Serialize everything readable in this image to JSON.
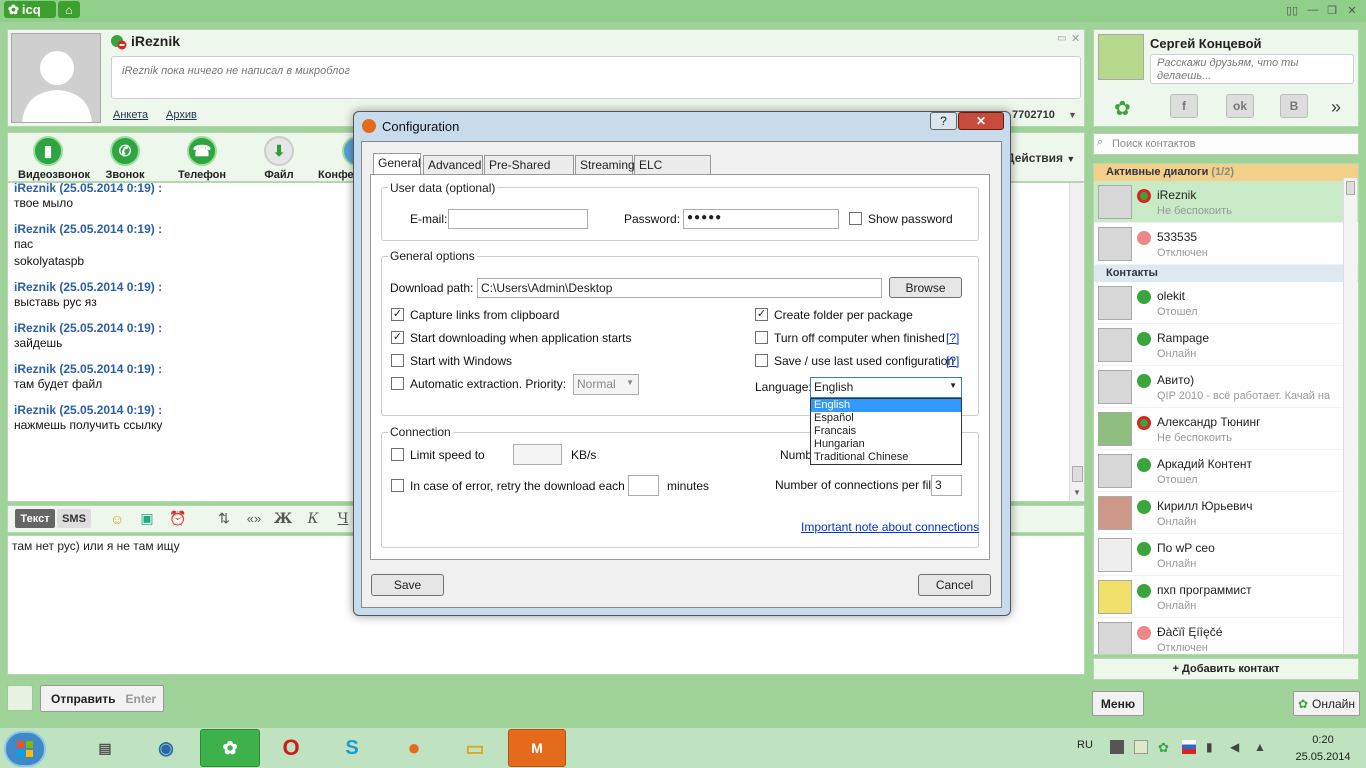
{
  "app": {
    "logo_text": "icq"
  },
  "chat": {
    "contact_name": "iReznik",
    "microblog": "iReznik пока ничего не написал в микроблог",
    "links": {
      "profile": "Анкета",
      "archive": "Архив"
    },
    "uin": "7702710",
    "actions_label": "Действия",
    "toolbar": [
      {
        "label": "Видеозвонок"
      },
      {
        "label": "Звонок"
      },
      {
        "label": "Телефон"
      },
      {
        "label": "Файл"
      },
      {
        "label": "Конфе"
      }
    ],
    "messages": [
      {
        "author": "iReznik (25.05.2014 0:19) :",
        "lines": [
          "твое мыло"
        ]
      },
      {
        "author": "iReznik (25.05.2014 0:19) :",
        "lines": [
          "пас",
          "sokolyataspb"
        ]
      },
      {
        "author": "iReznik (25.05.2014 0:19) :",
        "lines": [
          "выставь рус яз"
        ]
      },
      {
        "author": "iReznik (25.05.2014 0:19) :",
        "lines": [
          "зайдешь"
        ]
      },
      {
        "author": "iReznik (25.05.2014 0:19) :",
        "lines": [
          "там будет файл"
        ]
      },
      {
        "author": "iReznik (25.05.2014 0:19) :",
        "lines": [
          "нажмешь получить ссылку"
        ]
      }
    ],
    "mode_text": "Текст",
    "mode_sms": "SMS",
    "input_value": "там нет рус) или я не там ищу",
    "send_label": "Отправить",
    "send_hint": "Enter"
  },
  "profile": {
    "name": "Сергей Концевой",
    "status_placeholder": "Расскажи друзьям, что ты делаешь...",
    "search_placeholder": "Поиск контактов"
  },
  "contacts": {
    "active_group": "Активные диалоги",
    "active_count": "(1/2)",
    "contacts_group": "Контакты",
    "active": [
      {
        "name": "iReznik",
        "status": "Не беспокоить"
      },
      {
        "name": "533535",
        "status": "Отключен"
      }
    ],
    "list": [
      {
        "name": "olekit",
        "status": "Отошел"
      },
      {
        "name": "Rampage",
        "status": "Онлайн"
      },
      {
        "name": "Авито)",
        "status": "QIP 2010 - всё работает. Качай на"
      },
      {
        "name": "Александр Тюнинг",
        "status": "Не беспокоить"
      },
      {
        "name": "Аркадий Контент",
        "status": "Отошел"
      },
      {
        "name": "Кирилл Юрьевич",
        "status": "Онлайн"
      },
      {
        "name": "По wP сео",
        "status": "Онлайн"
      },
      {
        "name": "пхп программист",
        "status": "Онлайн"
      },
      {
        "name": "Ðàčïî Ęíîęčé",
        "status": "Отключен"
      }
    ],
    "add_label": "+ Добавить контакт"
  },
  "bottom": {
    "menu_label": "Меню",
    "status_label": "Онлайн"
  },
  "dialog": {
    "title": "Configuration",
    "help_label": "?",
    "tabs": [
      {
        "label": "General"
      },
      {
        "label": "Advanced"
      },
      {
        "label": "Pre-Shared Keys"
      },
      {
        "label": "Streaming"
      },
      {
        "label": "ELC Accounts"
      }
    ],
    "user_data": {
      "title": "User data (optional)",
      "email_label": "E-mail:",
      "email_value": "",
      "password_label": "Password:",
      "password_value": "●●●●●",
      "show_password": "Show password"
    },
    "general": {
      "title": "General options",
      "download_path_label": "Download path:",
      "download_path": "C:\\Users\\Admin\\Desktop",
      "browse": "Browse",
      "capture_links": "Capture links from clipboard",
      "start_downloading": "Start downloading when application starts",
      "start_windows": "Start with Windows",
      "auto_extract": "Automatic extraction. Priority:",
      "priority": "Normal",
      "create_folder": "Create folder per package",
      "turn_off": "Turn off computer when finished",
      "save_config": "Save / use last used configuration",
      "help_link": "[?]",
      "language_label": "Language:",
      "language_value": "English",
      "language_options": [
        "English",
        "Español",
        "Francais",
        "Hungarian",
        "Traditional Chinese"
      ]
    },
    "connection": {
      "title": "Connection",
      "limit_speed": "Limit speed to",
      "kbs": "KB/s",
      "number_label": "Numbe",
      "retry": "In case of error, retry the download each",
      "minutes": "minutes",
      "conn_per_file": "Number of connections per file:",
      "conn_value": "3",
      "important_link": "Important note about connections"
    },
    "save": "Save",
    "cancel": "Cancel"
  },
  "taskbar": {
    "lang": "RU",
    "time": "0:20",
    "date": "25.05.2014"
  }
}
